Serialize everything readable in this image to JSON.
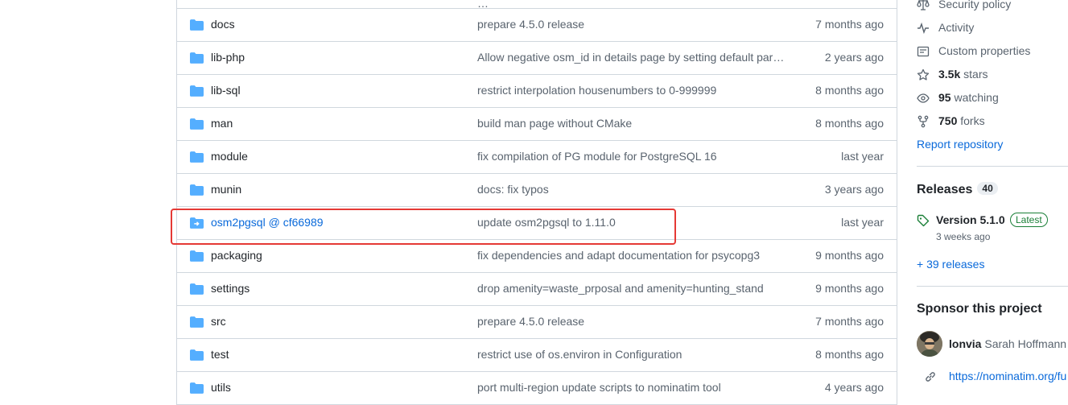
{
  "files": [
    {
      "name": "",
      "message": "…",
      "age": "",
      "type": "dir"
    },
    {
      "name": "docs",
      "message": "prepare 4.5.0 release",
      "age": "7 months ago",
      "type": "dir"
    },
    {
      "name": "lib-php",
      "message": "Allow negative osm_id in details page by setting default par…",
      "age": "2 years ago",
      "type": "dir"
    },
    {
      "name": "lib-sql",
      "message": "restrict interpolation housenumbers to 0-999999",
      "age": "8 months ago",
      "type": "dir"
    },
    {
      "name": "man",
      "message": "build man page without CMake",
      "age": "8 months ago",
      "type": "dir"
    },
    {
      "name": "module",
      "message": "fix compilation of PG module for PostgreSQL 16",
      "age": "last year",
      "type": "dir"
    },
    {
      "name": "munin",
      "message": "docs: fix typos",
      "age": "3 years ago",
      "type": "dir"
    },
    {
      "name": "osm2pgsql @ cf66989",
      "message": "update osm2pgsql to 1.11.0",
      "age": "last year",
      "type": "submodule"
    },
    {
      "name": "packaging",
      "message": "fix dependencies and adapt documentation for psycopg3",
      "age": "9 months ago",
      "type": "dir"
    },
    {
      "name": "settings",
      "message": "drop amenity=waste_prposal and amenity=hunting_stand",
      "age": "9 months ago",
      "type": "dir"
    },
    {
      "name": "src",
      "message": "prepare 4.5.0 release",
      "age": "7 months ago",
      "type": "dir"
    },
    {
      "name": "test",
      "message": "restrict use of os.environ in Configuration",
      "age": "8 months ago",
      "type": "dir"
    },
    {
      "name": "utils",
      "message": "port multi-region update scripts to nominatim tool",
      "age": "4 years ago",
      "type": "dir"
    }
  ],
  "sidebar": {
    "security_policy": "Security policy",
    "activity": "Activity",
    "custom_properties": "Custom properties",
    "stars_count": "3.5k",
    "stars_label": "stars",
    "watching_count": "95",
    "watching_label": "watching",
    "forks_count": "750",
    "forks_label": "forks",
    "report": "Report repository",
    "releases_title": "Releases",
    "releases_count": "40",
    "release_name": "Version 5.1.0",
    "release_badge": "Latest",
    "release_date": "3 weeks ago",
    "more_releases": "+ 39 releases",
    "sponsor_title": "Sponsor this project",
    "sponsor_user": "lonvia",
    "sponsor_name": "Sarah Hoffmann",
    "sponsor_url": "https://nominatim.org/fu"
  },
  "colors": {
    "folder": "#54aeff",
    "link": "#0969da",
    "highlight": "#e53935",
    "badge": "#1a7f37"
  }
}
